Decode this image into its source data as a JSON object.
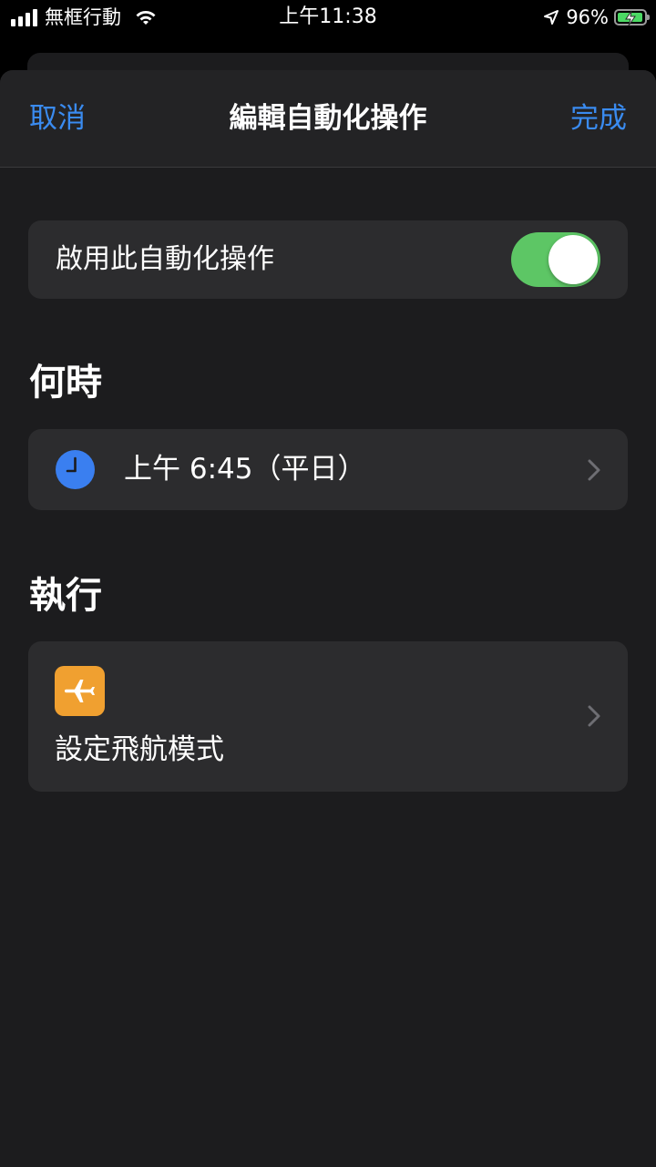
{
  "status_bar": {
    "carrier": "無框行動",
    "time": "上午11:38",
    "battery_percent": "96%",
    "battery_level": 0.96,
    "icons": [
      "signal-icon",
      "wifi-icon",
      "location-arrow-icon",
      "battery-charging-icon"
    ]
  },
  "nav": {
    "cancel_label": "取消",
    "title": "編輯自動化操作",
    "done_label": "完成"
  },
  "enable": {
    "label": "啟用此自動化操作",
    "on": true
  },
  "when_section": {
    "header": "何時",
    "trigger_text": "上午 6:45（平日）",
    "icon": "clock-icon"
  },
  "do_section": {
    "header": "執行",
    "action_text": "設定飛航模式",
    "icon": "airplane-icon"
  },
  "colors": {
    "accent": "#3a8bf0",
    "toggle_on": "#5dc665",
    "clock_blue": "#3a7ff0",
    "airplane_tile": "#f0a030",
    "sheet_bg": "#1c1c1e",
    "card_bg": "#2c2c2e"
  }
}
